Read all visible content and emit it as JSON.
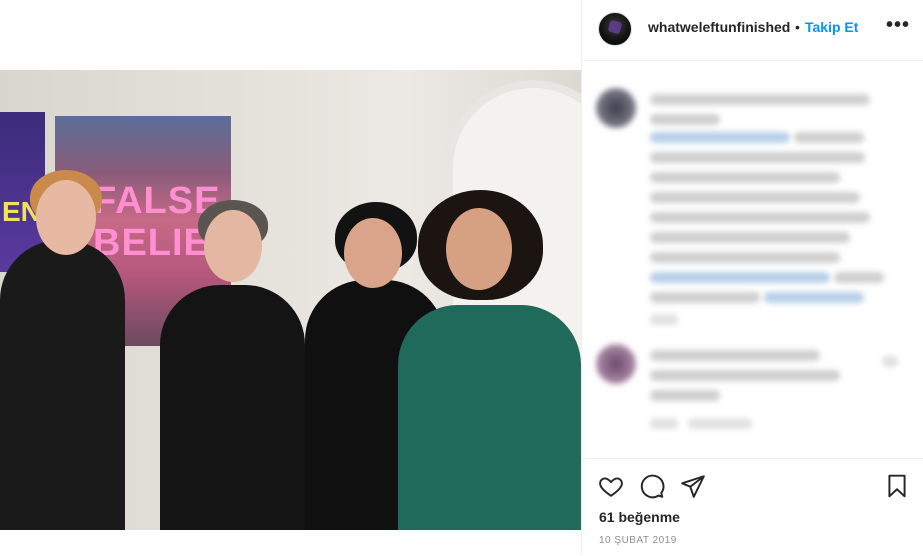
{
  "post": {
    "username": "whatweleftunfinished",
    "separator": "•",
    "follow_label": "Takip Et",
    "more_label": "•••",
    "likes": "61 beğenme",
    "date": "10 ŞUBAT 2019"
  },
  "photo": {
    "poster_title": "FALSE\nBELIEF",
    "poster_left_text": "EN"
  },
  "icons": {
    "like": "heart-icon",
    "comment": "comment-icon",
    "share": "paper-plane-icon",
    "save": "bookmark-icon"
  },
  "colors": {
    "follow": "#0095f6",
    "text": "#262626",
    "muted": "#8e8e8e"
  }
}
